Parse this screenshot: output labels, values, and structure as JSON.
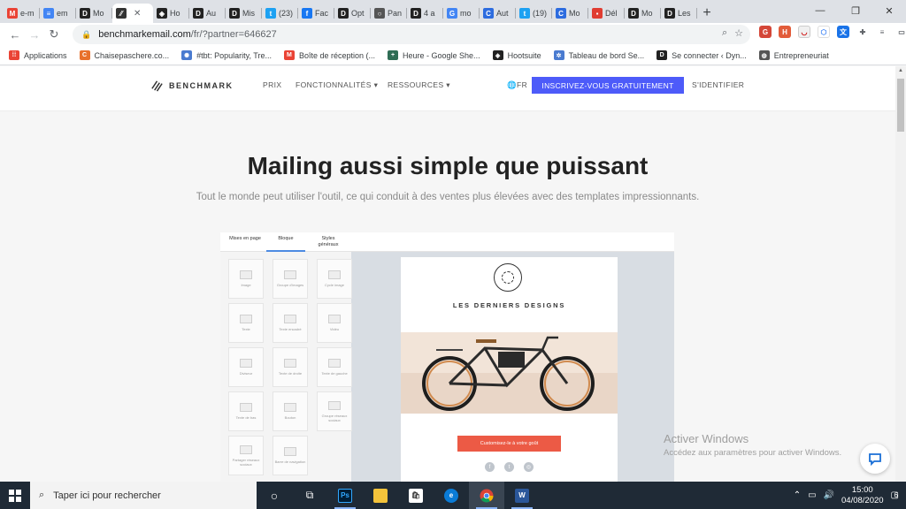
{
  "browser": {
    "tabs": [
      {
        "title": "e-m",
        "icon": "gmail-icon",
        "color": "#ea4335",
        "glyph": "M"
      },
      {
        "title": "em",
        "icon": "docs-icon",
        "color": "#4285f4",
        "glyph": "≡"
      },
      {
        "title": "Mo",
        "icon": "d-icon",
        "color": "#222222",
        "glyph": "D"
      },
      {
        "title": "",
        "icon": "benchmark-icon",
        "color": "#333333",
        "glyph": "⁄⁄",
        "active": true
      },
      {
        "title": "Ho",
        "icon": "hootsuite-icon",
        "color": "#222222",
        "glyph": "◈"
      },
      {
        "title": "Au",
        "icon": "d-icon",
        "color": "#222222",
        "glyph": "D"
      },
      {
        "title": "Mis",
        "icon": "d-icon",
        "color": "#222222",
        "glyph": "D"
      },
      {
        "title": "(23)",
        "icon": "twitter-icon",
        "color": "#1da1f2",
        "glyph": "t"
      },
      {
        "title": "Fac",
        "icon": "facebook-icon",
        "color": "#1877f2",
        "glyph": "f"
      },
      {
        "title": "Opt",
        "icon": "d-icon",
        "color": "#222222",
        "glyph": "D"
      },
      {
        "title": "Pan",
        "icon": "circle-icon",
        "color": "#555555",
        "glyph": "○"
      },
      {
        "title": "4 a",
        "icon": "d-icon",
        "color": "#222222",
        "glyph": "D"
      },
      {
        "title": "mo",
        "icon": "google-icon",
        "color": "#4285f4",
        "glyph": "G"
      },
      {
        "title": "Aut",
        "icon": "c-icon",
        "color": "#2d6cdf",
        "glyph": "C"
      },
      {
        "title": "(19)",
        "icon": "twitter-icon",
        "color": "#1da1f2",
        "glyph": "t"
      },
      {
        "title": "Mo",
        "icon": "c-icon",
        "color": "#2d6cdf",
        "glyph": "C"
      },
      {
        "title": "Dél",
        "icon": "flag-icon",
        "color": "#e03c31",
        "glyph": "▪"
      },
      {
        "title": "Mo",
        "icon": "d-icon",
        "color": "#222222",
        "glyph": "D"
      },
      {
        "title": "Les",
        "icon": "d-icon",
        "color": "#222222",
        "glyph": "D"
      }
    ],
    "url_host": "benchmarkemail.com",
    "url_path": "/fr/?partner=646627",
    "bookmarks": [
      {
        "label": "Applications",
        "icon": "apps-grid-icon",
        "color": "#ea4335",
        "glyph": "⁞⁞"
      },
      {
        "label": "Chaisepaschere.co...",
        "icon": "c-icon",
        "color": "#e8712c",
        "glyph": "C"
      },
      {
        "label": "#tbt: Popularity, Tre...",
        "icon": "globe-icon",
        "color": "#4a7bd0",
        "glyph": "✺"
      },
      {
        "label": "Boîte de réception (...",
        "icon": "gmail-icon",
        "color": "#ea4335",
        "glyph": "M"
      },
      {
        "label": "Heure - Google She...",
        "icon": "sheets-icon",
        "color": "#2f6d55",
        "glyph": "+"
      },
      {
        "label": "Hootsuite",
        "icon": "hootsuite-icon",
        "color": "#222222",
        "glyph": "◈"
      },
      {
        "label": "Tableau de bord Se...",
        "icon": "dashboard-icon",
        "color": "#4a7bd0",
        "glyph": "✲"
      },
      {
        "label": "Se connecter ‹ Dyn...",
        "icon": "d-icon",
        "color": "#222222",
        "glyph": "D"
      },
      {
        "label": "Entrepreneuriat",
        "icon": "globe-icon",
        "color": "#555555",
        "glyph": "◍"
      }
    ]
  },
  "site": {
    "brand": "BENCHMARK",
    "nav": {
      "prix": "PRIX",
      "features": "FONCTIONNALITÉS ▾",
      "resources": "RESSOURCES ▾",
      "lang": "🌐FR",
      "cta": "INSCRIVEZ-VOUS GRATUITEMENT",
      "login": "S'IDENTIFIER"
    },
    "hero_title": "Mailing aussi simple que puissant",
    "hero_subtitle": "Tout le monde peut utiliser l'outil, ce qui conduit à des ventes plus élevées avec des templates impressionnants."
  },
  "editor": {
    "tabs": [
      "Mises en page",
      "Bloque",
      "Styles généraux"
    ],
    "blocks": [
      "Image",
      "Groupe d'images",
      "Cycle image",
      "Texte",
      "Texte encadré",
      "Vidéo",
      "Diviseur",
      "Texte de droite",
      "Texte de gauche",
      "Texte de bas",
      "Bouton",
      "Groupe réseaux sociaux",
      "Partager réseaux sociaux",
      "Barre de navigation"
    ],
    "email_title": "LES DERNIERS DESIGNS",
    "email_cta": "Customisez-le à votre goût"
  },
  "windows": {
    "watermark_title": "Activer Windows",
    "watermark_sub": "Accédez aux paramètres pour activer Windows.",
    "search_placeholder": "Taper ici pour rechercher",
    "time": "15:00",
    "date": "04/08/2020",
    "notifications": "6"
  }
}
